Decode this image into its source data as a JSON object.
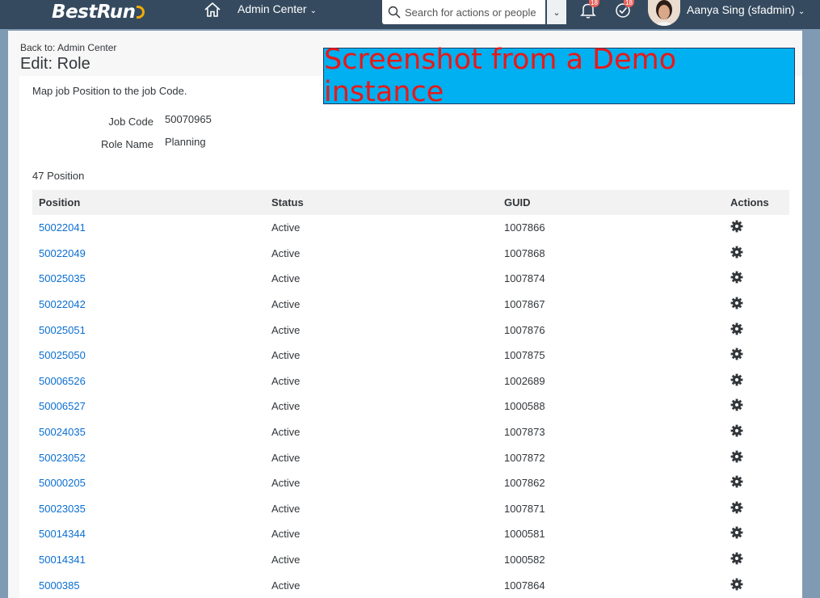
{
  "shell": {
    "logo_text": "BestRun",
    "nav_title": "Admin Center",
    "search_placeholder": "Search for actions or people",
    "notifications_badge": "18",
    "todo_badge": "18",
    "user_name": "Aanya Sing (sfadmin)",
    "colors": {
      "shell_bg": "#354a5f",
      "link": "#0a6ed1",
      "badge": "#e9605a"
    }
  },
  "header": {
    "back_link": "Back to: Admin Center",
    "title": "Edit: Role"
  },
  "form": {
    "description": "Map job Position to the job Code.",
    "job_code_label": "Job Code",
    "job_code_value": "50070965",
    "role_name_label": "Role Name",
    "role_name_value": "Planning"
  },
  "positions": {
    "count_text": "47 Position",
    "columns": [
      "Position",
      "Status",
      "GUID",
      "Actions"
    ],
    "rows": [
      {
        "position": "50022041",
        "status": "Active",
        "guid": "1007866"
      },
      {
        "position": "50022049",
        "status": "Active",
        "guid": "1007868"
      },
      {
        "position": "50025035",
        "status": "Active",
        "guid": "1007874"
      },
      {
        "position": "50022042",
        "status": "Active",
        "guid": "1007867"
      },
      {
        "position": "50025051",
        "status": "Active",
        "guid": "1007876"
      },
      {
        "position": "50025050",
        "status": "Active",
        "guid": "1007875"
      },
      {
        "position": "50006526",
        "status": "Active",
        "guid": "1002689"
      },
      {
        "position": "50006527",
        "status": "Active",
        "guid": "1000588"
      },
      {
        "position": "50024035",
        "status": "Active",
        "guid": "1007873"
      },
      {
        "position": "50023052",
        "status": "Active",
        "guid": "1007872"
      },
      {
        "position": "50000205",
        "status": "Active",
        "guid": "1007862"
      },
      {
        "position": "50023035",
        "status": "Active",
        "guid": "1007871"
      },
      {
        "position": "50014344",
        "status": "Active",
        "guid": "1000581"
      },
      {
        "position": "50014341",
        "status": "Active",
        "guid": "1000582"
      },
      {
        "position": "5000385",
        "status": "Active",
        "guid": "1007864"
      }
    ],
    "action_icon": "gear-icon"
  },
  "overlay": {
    "banner_text": "Screenshot from a Demo instance",
    "colors": {
      "bg": "#00b0f0",
      "text": "#e81818"
    }
  }
}
